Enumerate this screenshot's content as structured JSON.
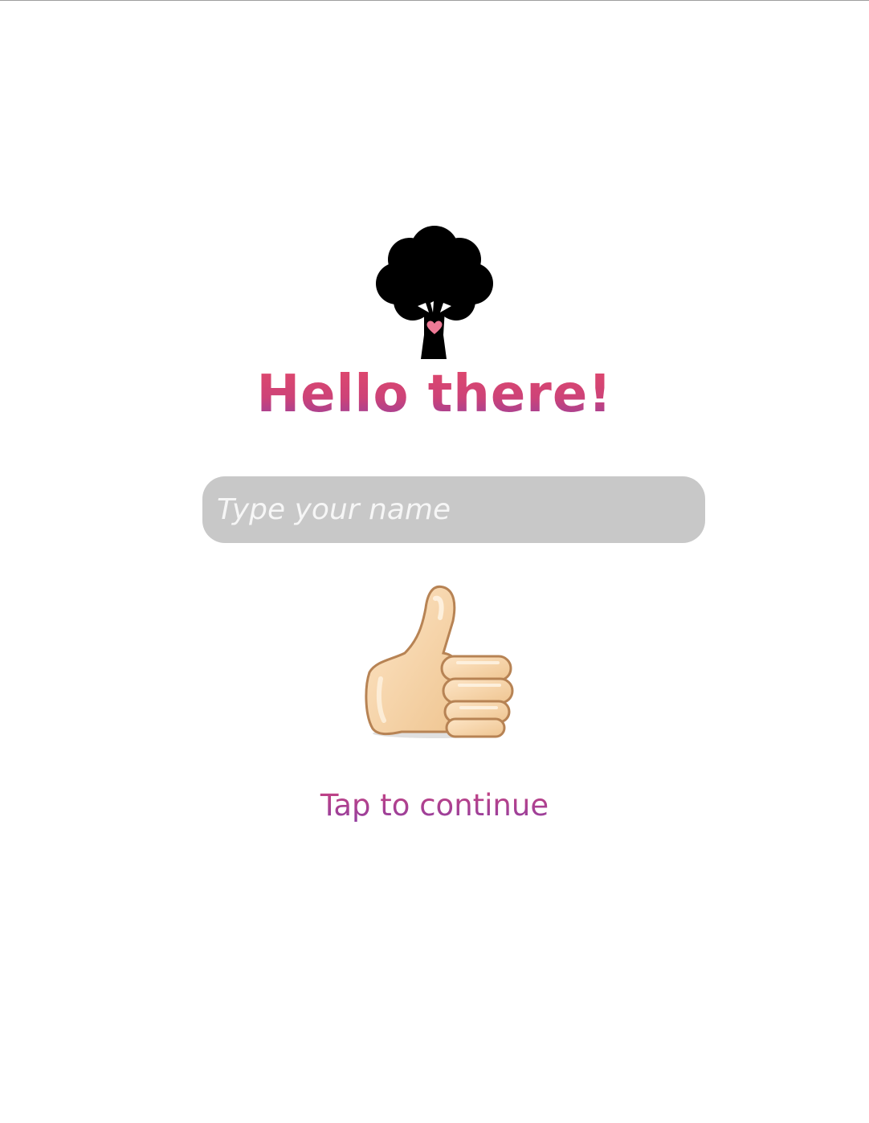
{
  "welcome": {
    "logo_icon": "tree-heart-icon",
    "title": "Hello there!",
    "title_gradient": [
      "#e3496a",
      "#8a3fa6"
    ],
    "name_input": {
      "placeholder": "Type your name",
      "value": ""
    },
    "confirm_icon": "thumbs-up-icon",
    "continue_label": "Tap to continue"
  },
  "colors": {
    "input_background": "#c8c8c8",
    "placeholder": "#f6f6f6",
    "accent_pink": "#e3496a",
    "accent_purple": "#8a3fa6"
  }
}
